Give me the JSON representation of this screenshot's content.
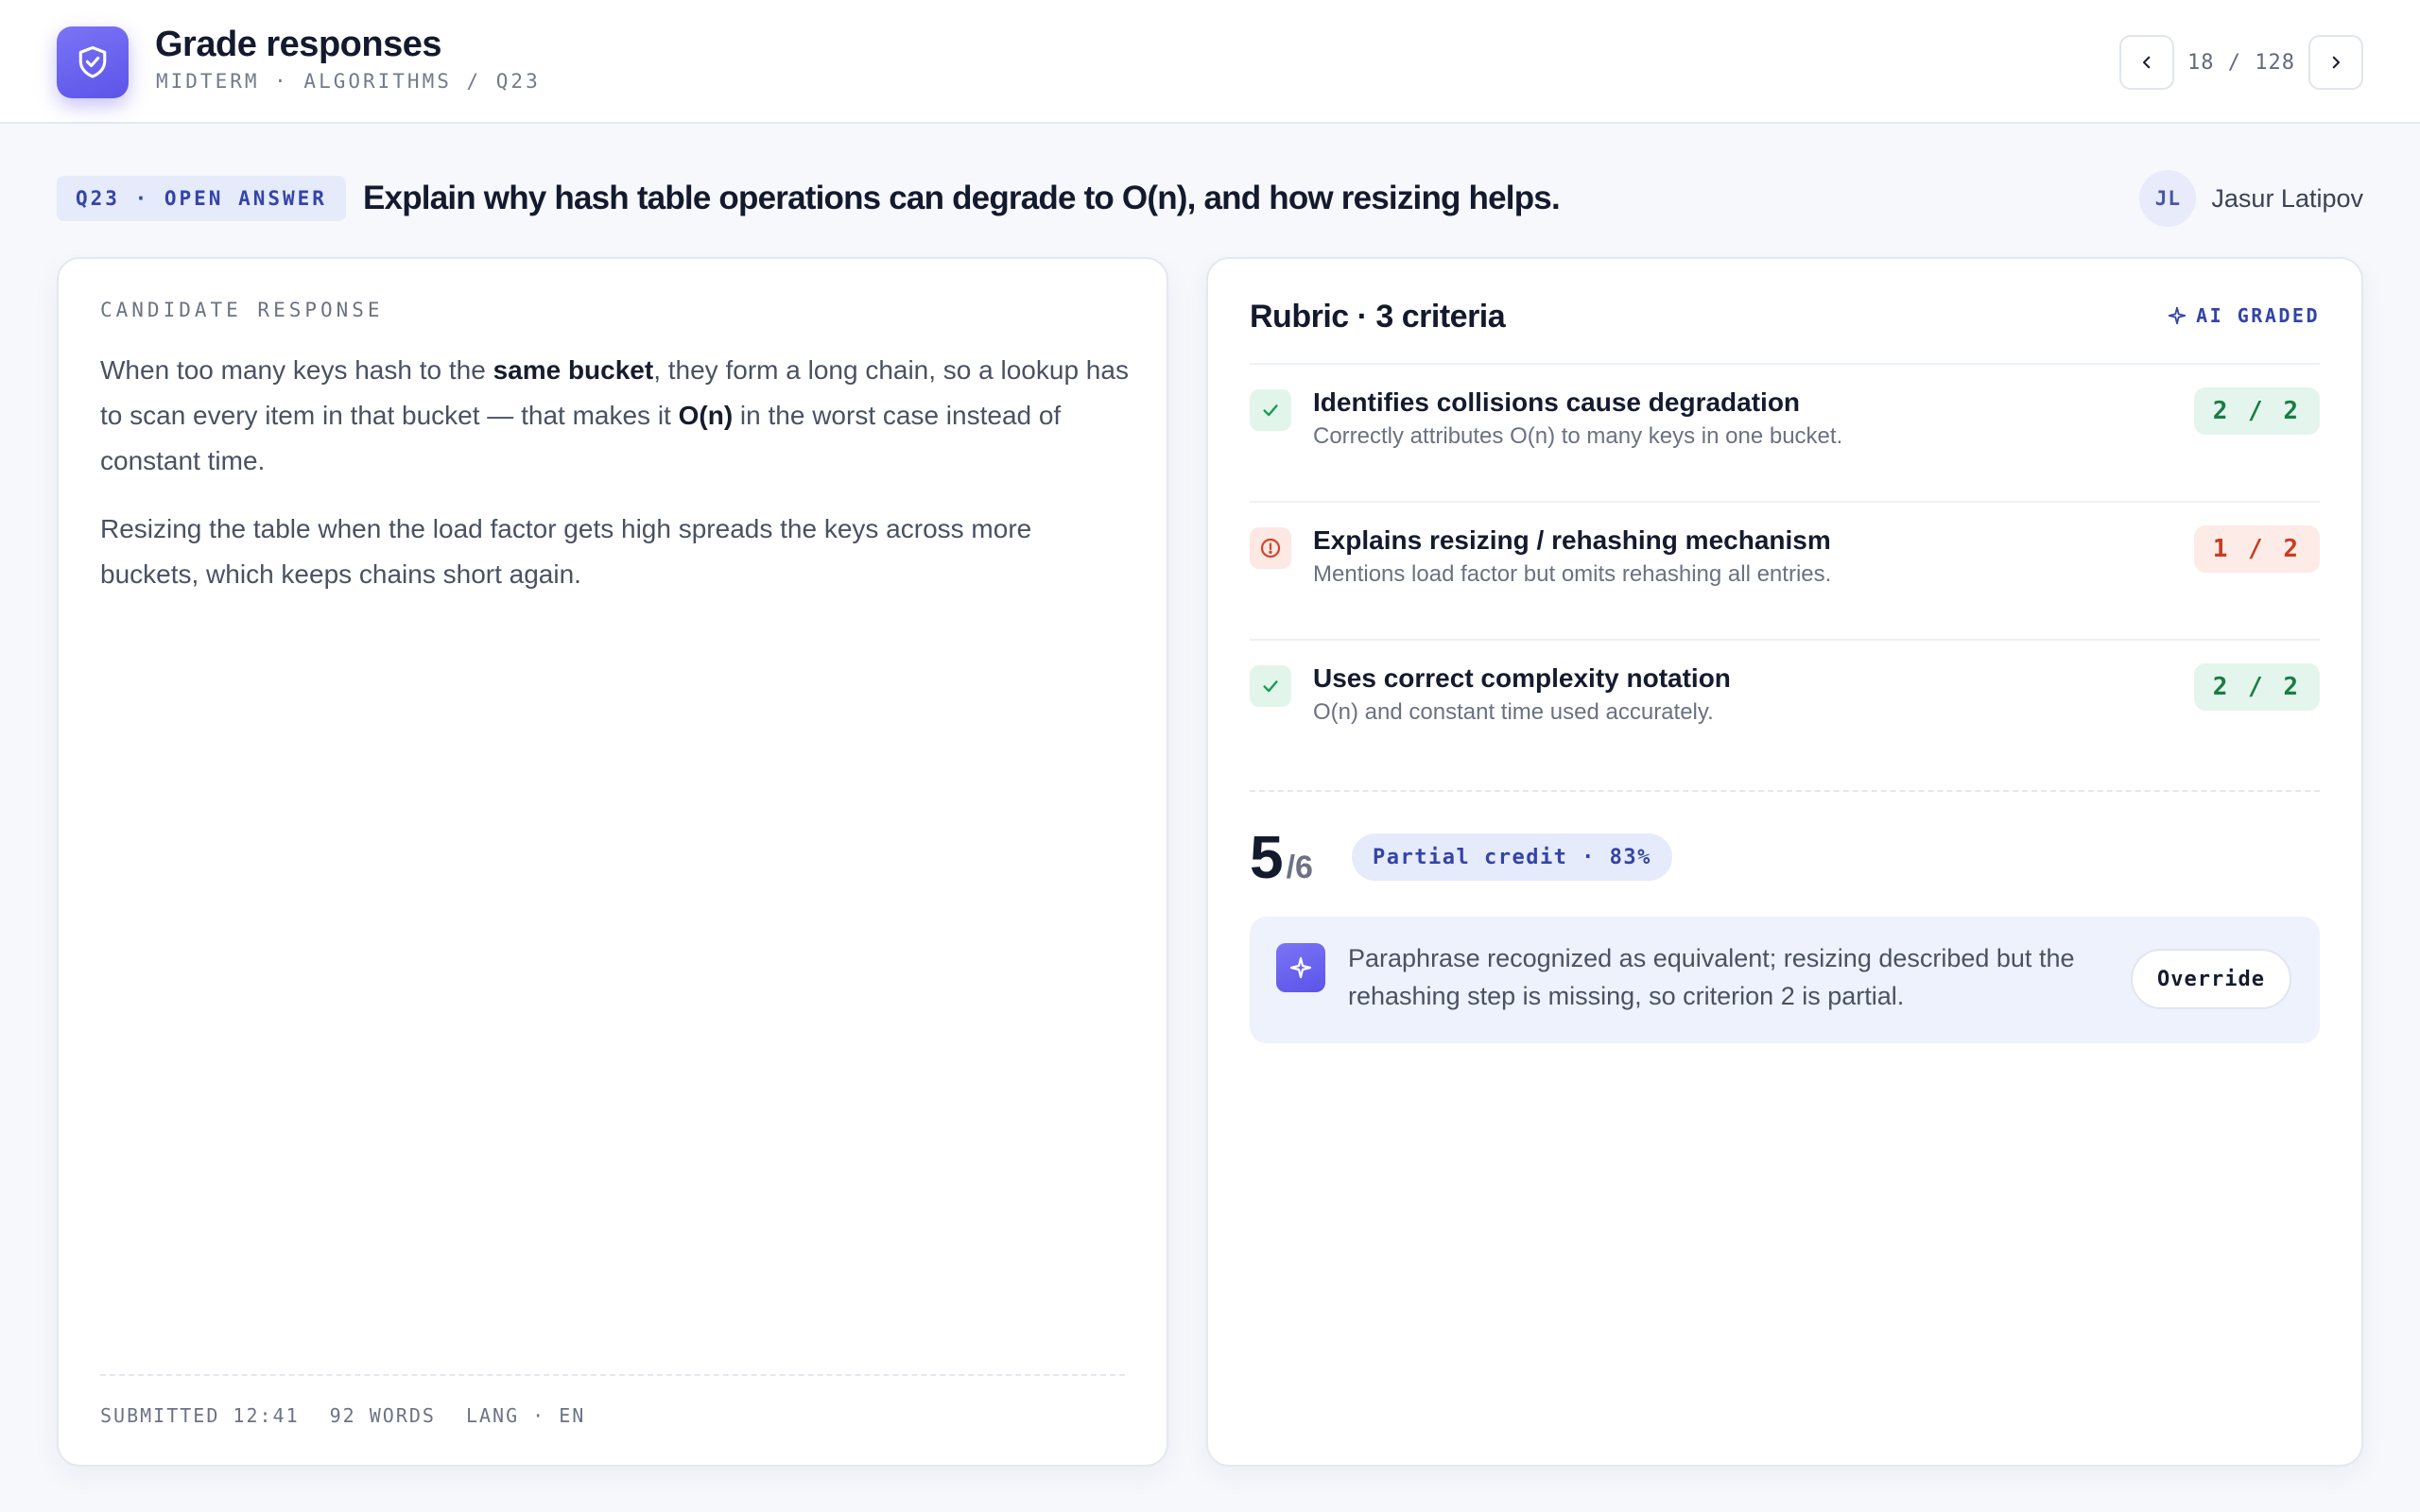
{
  "header": {
    "title": "Grade responses",
    "breadcrumb": "MIDTERM · ALGORITHMS / Q23",
    "pager": {
      "current": 18,
      "total": 128,
      "text": "18 / 128"
    }
  },
  "question": {
    "tag": "Q23 · OPEN ANSWER",
    "text": "Explain why hash table operations can degrade to O(n), and how resizing helps."
  },
  "student": {
    "initials": "JL",
    "name": "Jasur Latipov"
  },
  "response": {
    "label": "CANDIDATE RESPONSE",
    "p1_a": "When too many keys hash to the ",
    "p1_b": "same bucket",
    "p1_c": ", they form a long chain, so a lookup has to scan every item in that bucket — that makes it ",
    "p1_d": "O(n)",
    "p1_e": " in the worst case instead of constant time.",
    "p2": "Resizing the table when the load factor gets high spreads the keys across more buckets, which keeps chains short again.",
    "meta": {
      "submitted": "SUBMITTED 12:41",
      "words": "92 WORDS",
      "lang": "LANG · EN"
    }
  },
  "rubric": {
    "title": "Rubric · 3 criteria",
    "ai_badge": "AI GRADED",
    "criteria": [
      {
        "name": "Identifies collisions cause degradation",
        "desc": "Correctly attributes O(n) to many keys in one bucket.",
        "score": "2 / 2",
        "status": "full"
      },
      {
        "name": "Explains resizing / rehashing mechanism",
        "desc": "Mentions load factor but omits rehashing all entries.",
        "score": "1 / 2",
        "status": "partial"
      },
      {
        "name": "Uses correct complexity notation",
        "desc": "O(n) and constant time used accurately.",
        "score": "2 / 2",
        "status": "full"
      }
    ],
    "total": {
      "score": "5",
      "max": "/6",
      "credit": "Partial credit · 83%"
    },
    "note": "Paraphrase recognized as equivalent; resizing described but the rehashing step is missing, so criterion 2 is partial.",
    "override_label": "Override"
  },
  "colors": {
    "accent": "#5b54e8",
    "success": "#1a7c45",
    "warning": "#c73d24",
    "tag_bg": "#e6ebfb"
  }
}
